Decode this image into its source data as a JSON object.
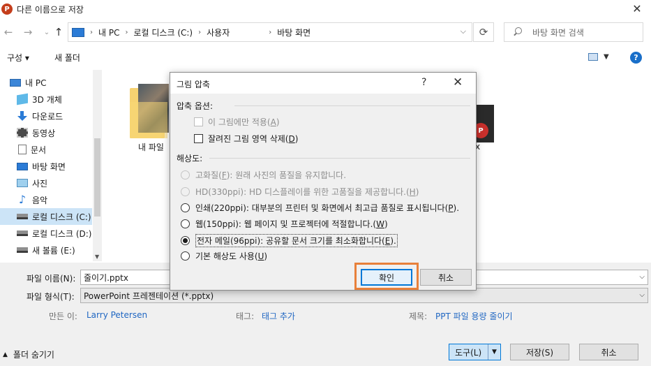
{
  "window": {
    "title": "다른 이름으로 저장",
    "app_icon": "P"
  },
  "nav": {
    "breadcrumb": [
      "내 PC",
      "로컬 디스크 (C:)",
      "사용자",
      "",
      "바탕 화면"
    ],
    "search_placeholder": "바탕 화면 검색"
  },
  "toolbar": {
    "organize": "구성 ▾",
    "new_folder": "새 폴더",
    "help": "?"
  },
  "sidebar": {
    "items": [
      {
        "label": "내 PC",
        "icon": "pc-icon"
      },
      {
        "label": "3D 개체",
        "icon": "3d-objects-icon"
      },
      {
        "label": "다운로드",
        "icon": "download-icon"
      },
      {
        "label": "동영상",
        "icon": "video-icon"
      },
      {
        "label": "문서",
        "icon": "document-icon"
      },
      {
        "label": "바탕 화면",
        "icon": "desktop-icon"
      },
      {
        "label": "사진",
        "icon": "pictures-icon"
      },
      {
        "label": "음악",
        "icon": "music-icon"
      },
      {
        "label": "로컬 디스크 (C:)",
        "icon": "drive-icon"
      },
      {
        "label": "로컬 디스크 (D:)",
        "icon": "drive-icon"
      },
      {
        "label": "새 볼륨 (E:)",
        "icon": "drive-icon"
      }
    ]
  },
  "files": [
    {
      "label": "내 파일"
    },
    {
      "label": "x"
    }
  ],
  "save_form": {
    "filename_label": "파일 이름(N):",
    "filename_value": "줄이기.pptx",
    "filetype_label": "파일 형식(T):",
    "filetype_value": "PowerPoint 프레젠테이션 (*.pptx)",
    "author_label": "만든 이:",
    "author_value": "Larry Petersen",
    "tags_label": "태그:",
    "tags_value": "태그 추가",
    "title_label": "제목:",
    "title_value": "PPT 파일 용량 줄이기",
    "hide_folders": "폴더 숨기기",
    "tools_button": "도구(L)",
    "save_button": "저장(S)",
    "cancel_button": "취소"
  },
  "dialog": {
    "title": "그림 압축",
    "help": "?",
    "compress_group": "압축 옵션:",
    "apply_only_pre": "이 그림에만 적용(",
    "apply_only_key": "A",
    "apply_only_post": ")",
    "delete_cropped_pre": "잘려진 그림 영역 삭제(",
    "delete_cropped_key": "D",
    "delete_cropped_post": ")",
    "resolution_group": "해상도:",
    "options": [
      {
        "pre": "고화질(",
        "key": "F",
        "post": "): 원래 사진의 품질을 유지합니다."
      },
      {
        "pre": "HD(330ppi): HD 디스플레이를 위한 고품질을 제공합니다.(",
        "key": "H",
        "post": ")"
      },
      {
        "pre": "인쇄(220ppi): 대부분의 프린터 및 화면에서 최고급 품질로 표시됩니다(",
        "key": "P",
        "post": ")."
      },
      {
        "pre": "웹(150ppi): 웹 페이지 및 프로젝터에 적절합니다.(",
        "key": "W",
        "post": ")"
      },
      {
        "pre": "전자 메일(96ppi): 공유할 문서 크기를 최소화합니다(",
        "key": "E",
        "post": ")."
      },
      {
        "pre": "기본 해상도 사용(",
        "key": "U",
        "post": ")"
      }
    ],
    "ok_button": "확인",
    "cancel_button": "취소"
  },
  "colors": {
    "highlight": "#e8803a",
    "accent": "#0078d7",
    "link": "#1f66c2"
  }
}
